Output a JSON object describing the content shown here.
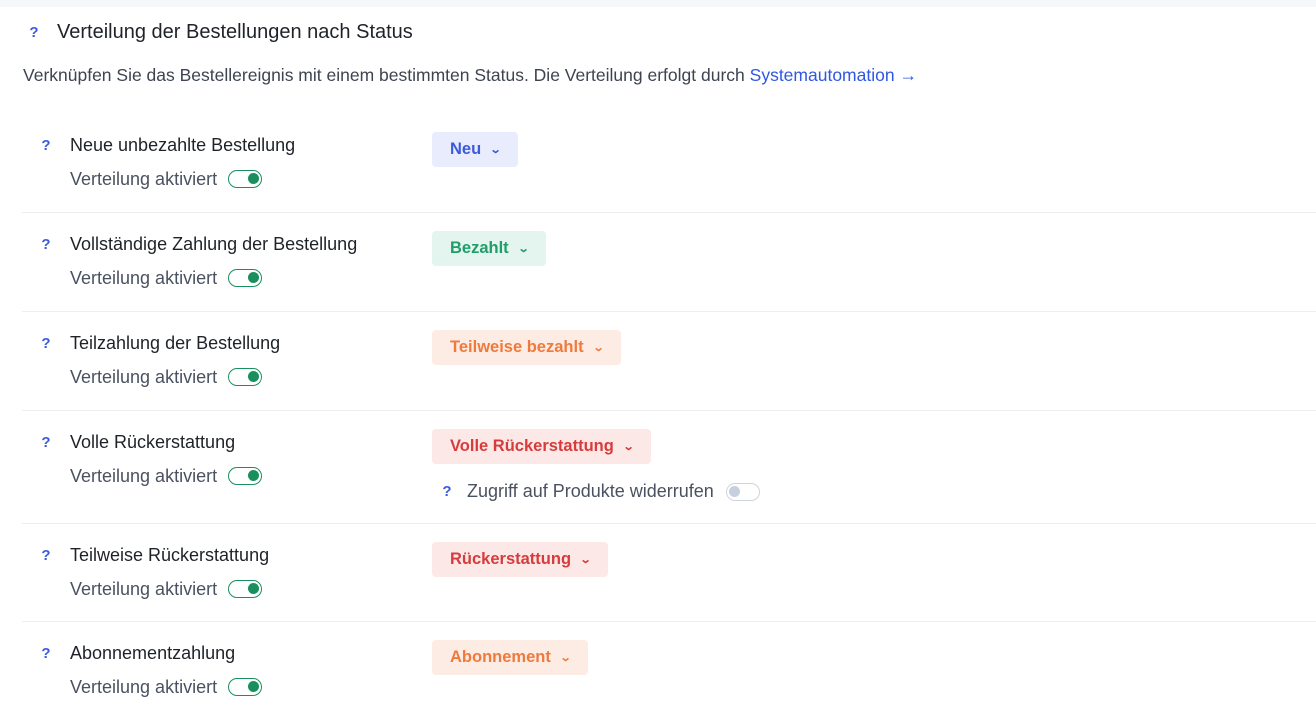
{
  "header": {
    "title": "Verteilung der Bestellungen nach Status",
    "help": "?"
  },
  "description": {
    "text": "Verknüpfen Sie das Bestellereignis mit einem bestimmten Status. Die Verteilung erfolgt durch ",
    "link": "Systemautomation",
    "arrow": "→"
  },
  "rows": [
    {
      "name": "Neue unbezahlte Bestellung",
      "toggle_label": "Verteilung aktiviert",
      "toggle_on": true,
      "status": "Neu",
      "status_color": "#3b5bdb"
    },
    {
      "name": "Vollständige Zahlung der Bestellung",
      "toggle_label": "Verteilung aktiviert",
      "toggle_on": true,
      "status": "Bezahlt",
      "status_color": "#1f9d6a"
    },
    {
      "name": "Teilzahlung der Bestellung",
      "toggle_label": "Verteilung aktiviert",
      "toggle_on": true,
      "status": "Teilweise bezahlt",
      "status_color": "#ef7a3e"
    },
    {
      "name": "Volle Rückerstattung",
      "toggle_label": "Verteilung aktiviert",
      "toggle_on": true,
      "status": "Volle Rückerstattung",
      "status_color": "#d63c3c",
      "extra": {
        "label": "Zugriff auf Produkte widerrufen",
        "toggle_on": false
      }
    },
    {
      "name": "Teilweise Rückerstattung",
      "toggle_label": "Verteilung aktiviert",
      "toggle_on": true,
      "status": "Rückerstattung",
      "status_color": "#d63c3c"
    },
    {
      "name": "Abonnementzahlung",
      "toggle_label": "Verteilung aktiviert",
      "toggle_on": true,
      "status": "Abonnement",
      "status_color": "#ef7a3e"
    }
  ],
  "icons": {
    "help": "question-mark-icon",
    "dropdown": "chevron-down-icon"
  }
}
